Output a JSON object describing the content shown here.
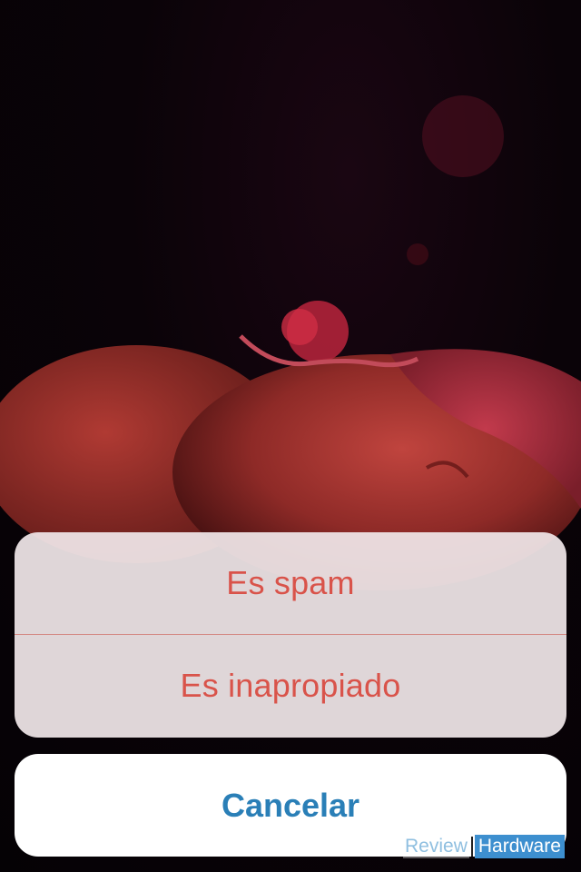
{
  "action_sheet": {
    "options": [
      {
        "label": "Es spam"
      },
      {
        "label": "Es inapropiado"
      }
    ],
    "cancel_label": "Cancelar",
    "colors": {
      "destructive_text": "#d9534a",
      "cancel_text": "#2a7fb7",
      "sheet_background": "#f0e6e8",
      "cancel_background": "#ffffff"
    }
  },
  "watermark": {
    "part1": "Review",
    "part2": "Hardware"
  }
}
